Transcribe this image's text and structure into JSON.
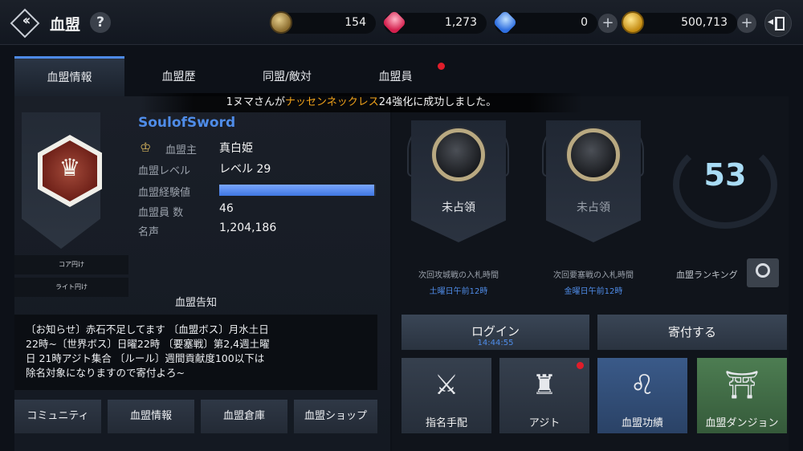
{
  "header": {
    "title": "血盟",
    "help_icon": "?",
    "currencies": [
      {
        "icon": "medal-icon",
        "value": "154"
      },
      {
        "icon": "ruby-gem-icon",
        "value": "1,273"
      },
      {
        "icon": "sapphire-gem-icon",
        "value": "0"
      },
      {
        "icon": "gold-coin-icon",
        "value": "500,713"
      }
    ]
  },
  "tabs": [
    {
      "label": "血盟情報",
      "active": true
    },
    {
      "label": "血盟歴"
    },
    {
      "label": "同盟/敵対"
    },
    {
      "label": "血盟員",
      "has_alert": true
    }
  ],
  "notification": {
    "before": "1ヌマさんが",
    "highlight": "ナッセンネックレス",
    "after": "24強化に成功しました。"
  },
  "side_buttons": [
    "コア円け",
    "ライト円け"
  ],
  "guild": {
    "name": "SoulofSword",
    "labels": {
      "master": "血盟主",
      "level": "血盟レベル",
      "exp": "血盟経験値",
      "members": "血盟員 数",
      "fame": "名声"
    },
    "values": {
      "master": "真白姫",
      "level": "レベル 29",
      "exp_fraction": 0.99,
      "members": "46",
      "fame": "1,204,186"
    }
  },
  "notice": {
    "title": "血盟告知",
    "lines": [
      "〔お知らせ〕赤石不足してます 〔血盟ボス〕月水土日",
      "22時~〔世界ボス〕日曜22時 〔要塞戦〕第2,4週土曜",
      "日 21時アジト集合 〔ルール〕週間貢献度100以下は",
      "除名対象になりますので寄付よろ~"
    ]
  },
  "bottom_buttons": [
    "コミュニティ",
    "血盟情報",
    "血盟倉庫",
    "血盟ショップ"
  ],
  "territories": [
    {
      "status": "未占領",
      "label": "次回攻城戦の入札時間",
      "time": "土曜日午前12時"
    },
    {
      "status": "未占領",
      "label": "次回要塞戦の入札時間",
      "time": "金曜日午前12時"
    }
  ],
  "ranking": {
    "value": "53",
    "label": "血盟ランキング"
  },
  "actions": {
    "login_label": "ログイン",
    "login_time": "14:44:55",
    "donate_label": "寄付する"
  },
  "tiles": [
    {
      "label": "指名手配",
      "icon": "wanted-helmet-icon"
    },
    {
      "label": "アジト",
      "icon": "castle-icon",
      "has_alert": true
    },
    {
      "label": "血盟功績",
      "icon": "lion-crest-icon"
    },
    {
      "label": "血盟ダンジョン",
      "icon": "dungeon-gate-icon"
    }
  ],
  "colors": {
    "accent_blue": "#4f8ce8",
    "highlight_orange": "#f0a21a",
    "alert_red": "#e01d2a",
    "tile_blue": "#2f4a73",
    "tile_green": "#3d6a44"
  }
}
